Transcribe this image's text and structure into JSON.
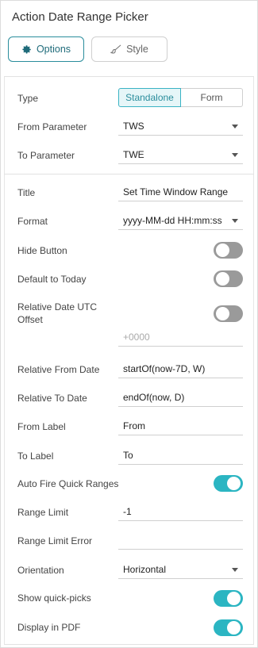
{
  "title": "Action Date Range Picker",
  "tabs": {
    "options": "Options",
    "style": "Style"
  },
  "type": {
    "label": "Type",
    "options": [
      "Standalone",
      "Form"
    ],
    "selected": "Standalone"
  },
  "from_parameter": {
    "label": "From Parameter",
    "value": "TWS"
  },
  "to_parameter": {
    "label": "To Parameter",
    "value": "TWE"
  },
  "title_field": {
    "label": "Title",
    "value": "Set Time Window Range"
  },
  "format": {
    "label": "Format",
    "value": "yyyy-MM-dd HH:mm:ss"
  },
  "hide_button": {
    "label": "Hide Button",
    "on": false
  },
  "default_today": {
    "label": "Default to Today",
    "on": false
  },
  "relative_utc": {
    "label": "Relative Date UTC Offset",
    "on": false,
    "placeholder": "+0000"
  },
  "relative_from": {
    "label": "Relative From Date",
    "value": "startOf(now-7D, W)"
  },
  "relative_to": {
    "label": "Relative To Date",
    "value": "endOf(now, D)"
  },
  "from_label": {
    "label": "From Label",
    "value": "From"
  },
  "to_label": {
    "label": "To Label",
    "value": "To"
  },
  "auto_fire": {
    "label": "Auto Fire Quick Ranges",
    "on": true
  },
  "range_limit": {
    "label": "Range Limit",
    "value": "-1"
  },
  "range_limit_error": {
    "label": "Range Limit Error",
    "value": ""
  },
  "orientation": {
    "label": "Orientation",
    "value": "Horizontal"
  },
  "show_quick_picks": {
    "label": "Show quick-picks",
    "on": true
  },
  "display_pdf": {
    "label": "Display in PDF",
    "on": true
  },
  "colors": {
    "accent": "#2bb5c2",
    "toggle_off": "#9a9a9a"
  }
}
